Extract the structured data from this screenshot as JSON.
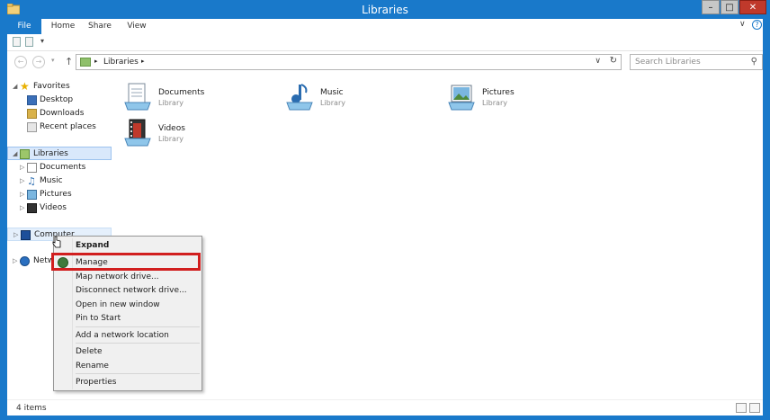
{
  "window": {
    "title": "Libraries"
  },
  "ribbon": {
    "tabs": [
      "File",
      "Home",
      "Share",
      "View"
    ],
    "caret": "∨",
    "help": "?"
  },
  "address": {
    "crumbs": [
      "Libraries"
    ],
    "search_placeholder": "Search Libraries"
  },
  "navigation": {
    "favorites_label": "Favorites",
    "favorites": [
      "Desktop",
      "Downloads",
      "Recent places"
    ],
    "libraries_label": "Libraries",
    "libraries": [
      "Documents",
      "Music",
      "Pictures",
      "Videos"
    ],
    "computer_label": "Computer",
    "network_label": "Netw"
  },
  "library_items": [
    {
      "name": "Documents",
      "type": "Library",
      "icon": "documents-library-icon"
    },
    {
      "name": "Music",
      "type": "Library",
      "icon": "music-library-icon"
    },
    {
      "name": "Pictures",
      "type": "Library",
      "icon": "pictures-library-icon"
    },
    {
      "name": "Videos",
      "type": "Library",
      "icon": "videos-library-icon"
    }
  ],
  "context_menu": {
    "items": [
      "Expand",
      "Manage",
      "Map network drive...",
      "Disconnect network drive...",
      "Open in new window",
      "Pin to Start",
      "Add a network location",
      "Delete",
      "Rename",
      "Properties"
    ],
    "highlighted": "Manage"
  },
  "status": {
    "item_count": "4 items"
  },
  "colors": {
    "titlebar": "#1979ca",
    "highlight_box": "#d11f1f",
    "selection": "#d9e8fb"
  }
}
